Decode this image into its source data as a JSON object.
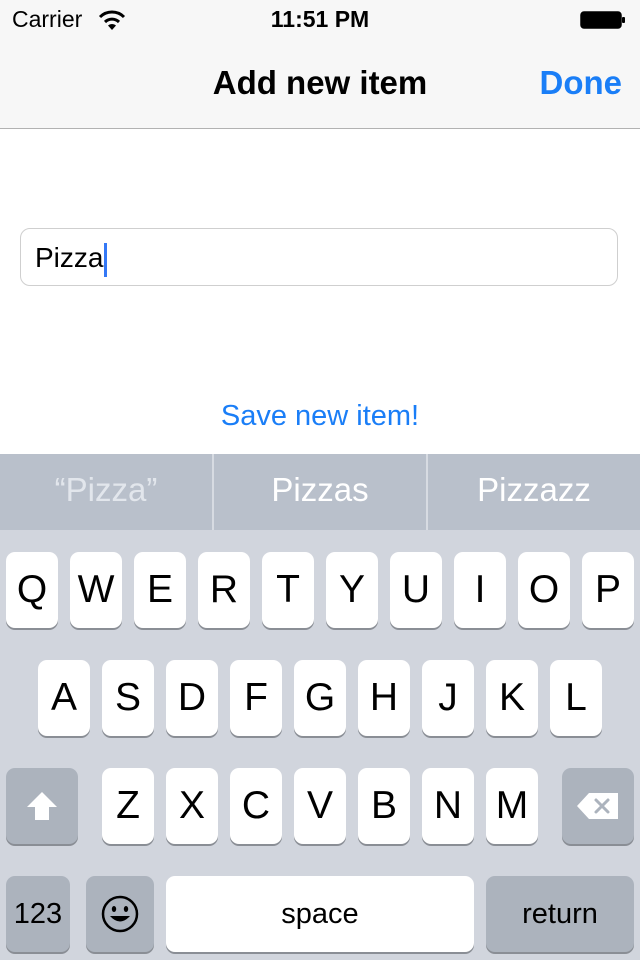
{
  "status_bar": {
    "carrier": "Carrier",
    "time": "11:51 PM"
  },
  "nav": {
    "title": "Add new item",
    "done_label": "Done"
  },
  "form": {
    "item_value": "Pizza",
    "save_label": "Save new item!"
  },
  "keyboard": {
    "suggestions": [
      "“Pizza”",
      "Pizzas",
      "Pizzazz"
    ],
    "row1": [
      "Q",
      "W",
      "E",
      "R",
      "T",
      "Y",
      "U",
      "I",
      "O",
      "P"
    ],
    "row2": [
      "A",
      "S",
      "D",
      "F",
      "G",
      "H",
      "J",
      "K",
      "L"
    ],
    "row3": [
      "Z",
      "X",
      "C",
      "V",
      "B",
      "N",
      "M"
    ],
    "numbers_label": "123",
    "space_label": "space",
    "return_label": "return",
    "icons": {
      "shift": "shift-icon",
      "delete": "delete-icon",
      "emoji": "emoji-icon"
    }
  },
  "colors": {
    "accent": "#1a7ef7",
    "caret": "#3478f6",
    "keyboard_bg": "#d1d5dd",
    "suggestion_bar": "#b9c0cb"
  }
}
